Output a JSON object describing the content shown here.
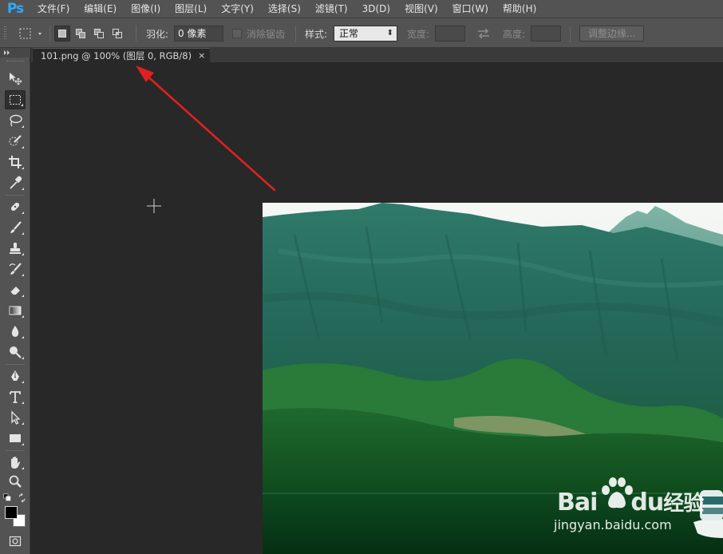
{
  "app": {
    "logo": "Ps"
  },
  "menu": [
    "文件(F)",
    "编辑(E)",
    "图像(I)",
    "图层(L)",
    "文字(Y)",
    "选择(S)",
    "滤镜(T)",
    "3D(D)",
    "视图(V)",
    "窗口(W)",
    "帮助(H)"
  ],
  "options": {
    "feather_label": "羽化:",
    "feather_value": "0 像素",
    "antialias_label": "消除锯齿",
    "style_label": "样式:",
    "style_value": "正常",
    "width_label": "宽度:",
    "height_label": "高度:",
    "refine_edge_button": "调整边缘..."
  },
  "document": {
    "tab_title": "101.png @ 100% (图层 0, RGB/8)",
    "close": "×"
  },
  "tools": [
    "move-tool",
    "rect-marquee-tool",
    "lasso-tool",
    "quick-selection-tool",
    "crop-tool",
    "eyedropper-tool",
    "healing-brush-tool",
    "brush-tool",
    "clone-stamp-tool",
    "history-brush-tool",
    "eraser-tool",
    "gradient-tool",
    "blur-tool",
    "dodge-tool",
    "pen-tool",
    "type-tool",
    "path-selection-tool",
    "rectangle-tool",
    "hand-tool",
    "zoom-tool"
  ],
  "colors": {
    "foreground": "#000000",
    "background": "#ffffff",
    "annotation_arrow": "#e02020",
    "ui_panel": "#535353",
    "canvas_bg": "#282828"
  },
  "watermark": {
    "brand_latin": "Bai",
    "brand_latin_2": "du",
    "brand_cn": "经验",
    "url": "jingyan.baidu.com"
  }
}
